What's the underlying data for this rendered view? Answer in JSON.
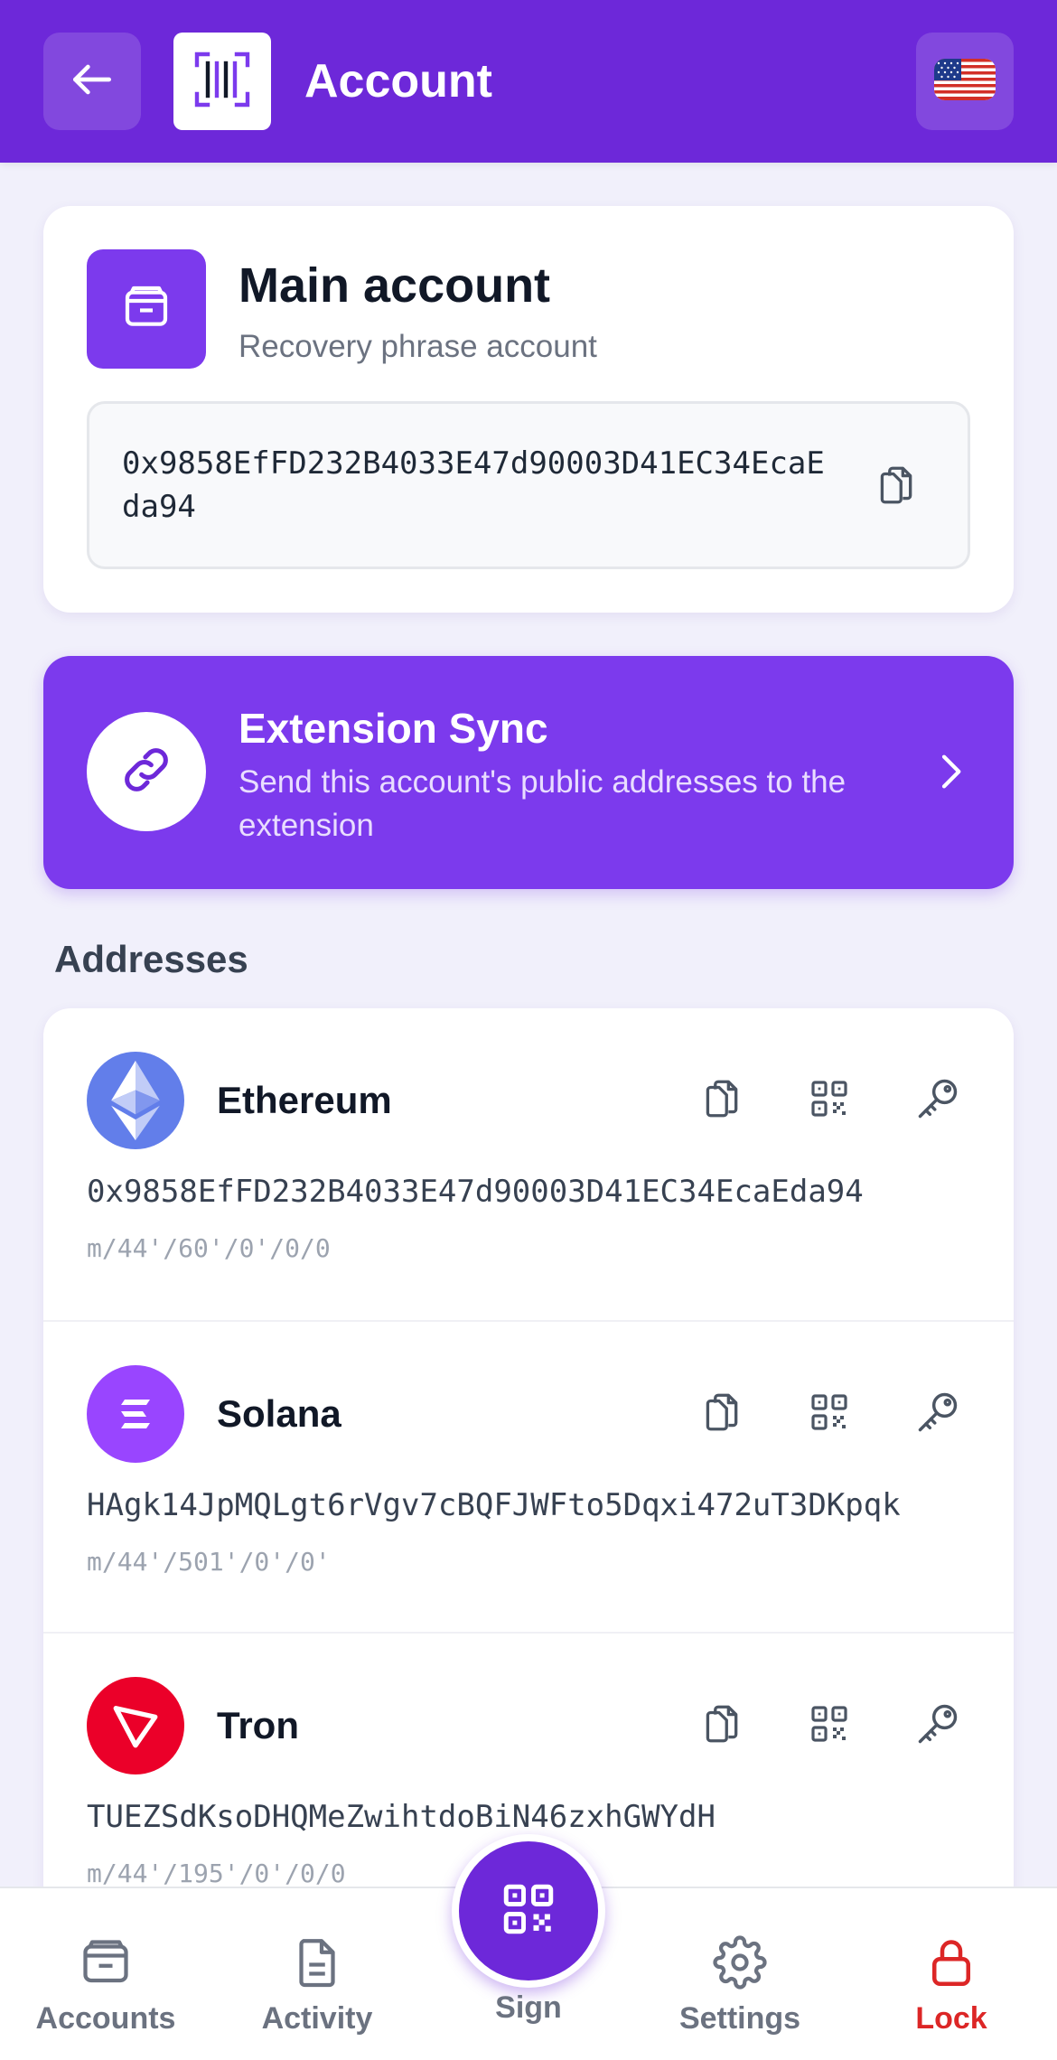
{
  "header": {
    "title": "Account",
    "back_icon": "arrow-left-icon",
    "logo_icon": "barcode-logo-icon",
    "language_icon": "us-flag-icon",
    "color": "#6d28d9"
  },
  "account": {
    "name": "Main account",
    "subtitle": "Recovery phrase account",
    "address": "0x9858EfFD232B4033E47d90003D41EC34EcaEda94",
    "icon": "wallet-icon"
  },
  "extension_sync": {
    "title": "Extension Sync",
    "description": "Send this account's public addresses to the extension",
    "icon": "link-icon",
    "color": "#7c3aed"
  },
  "addresses": {
    "section_title": "Addresses",
    "items": [
      {
        "chain": "Ethereum",
        "address": "0x9858EfFD232B4033E47d90003D41EC34EcaEda94",
        "path": "m/44'/60'/0'/0/0",
        "icon": "ethereum-icon",
        "color": "#627eea"
      },
      {
        "chain": "Solana",
        "address": "HAgk14JpMQLgt6rVgv7cBQFJWFto5Dqxi472uT3DKpqk",
        "path": "m/44'/501'/0'/0'",
        "icon": "solana-icon",
        "color": "#9945ff"
      },
      {
        "chain": "Tron",
        "address": "TUEZSdKsoDHQMeZwihtdoBiN46zxhGWYdH",
        "path": "m/44'/195'/0'/0/0",
        "icon": "tron-icon",
        "color": "#eb0029"
      }
    ]
  },
  "nav": {
    "accounts": "Accounts",
    "activity": "Activity",
    "sign": "Sign",
    "settings": "Settings",
    "lock": "Lock",
    "lock_color": "#dc2626"
  }
}
